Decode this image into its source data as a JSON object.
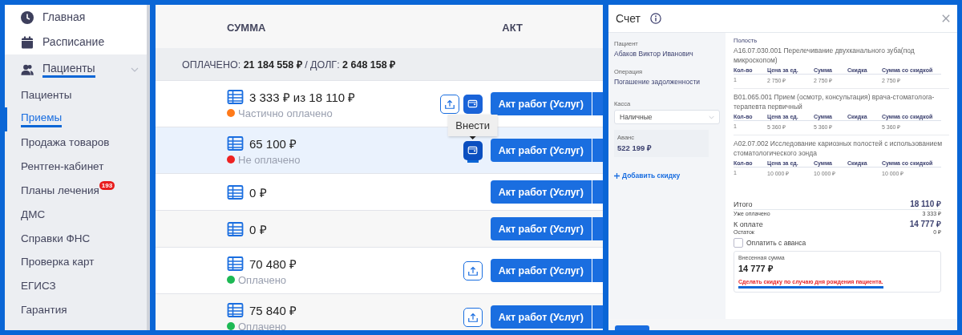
{
  "sidebar": {
    "items": [
      {
        "label": "Главная",
        "highlighted": false
      },
      {
        "label": "Расписание",
        "highlighted": false
      },
      {
        "label": "Пациенты",
        "expanded": true,
        "highlighted": true,
        "children": [
          {
            "label": "Пациенты",
            "selected": false,
            "highlighted": false
          },
          {
            "label": "Приемы",
            "selected": true,
            "highlighted": true
          },
          {
            "label": "Продажа товаров",
            "selected": false,
            "highlighted": false
          },
          {
            "label": "Рентген-кабинет",
            "selected": false,
            "highlighted": false
          },
          {
            "label": "Планы лечения",
            "selected": false,
            "highlighted": false,
            "badge": "193"
          },
          {
            "label": "ДМС",
            "selected": false,
            "highlighted": false
          },
          {
            "label": "Справки ФНС",
            "selected": false,
            "highlighted": false
          },
          {
            "label": "Проверка карт",
            "selected": false,
            "highlighted": false
          },
          {
            "label": "ЕГИСЗ",
            "selected": false,
            "highlighted": false
          },
          {
            "label": "Гарантия",
            "selected": false,
            "highlighted": false
          }
        ]
      }
    ]
  },
  "table": {
    "columns": [
      "СУММА",
      "АКТ"
    ],
    "summary": {
      "paid_label": "ОПЛАЧЕНО:",
      "paid": "21 184 558 ₽",
      "separator": "/",
      "debt_label": "ДОЛГ:",
      "debt": "2 648 158 ₽"
    },
    "rows": [
      {
        "amount": "3 333 ₽ из 18 110 ₽",
        "status": "Частично оплачено",
        "color": "#ff7a1a",
        "selected": false,
        "actions": [
          {
            "kind": "upload",
            "highlighted": false
          },
          {
            "kind": "wallet",
            "highlighted": false
          }
        ],
        "act": "Акт работ (Услуг)"
      },
      {
        "amount": "65 100 ₽",
        "status": "Не оплачено",
        "color": "#ee2222",
        "selected": true,
        "actions": [
          {
            "kind": "wallet",
            "highlighted": true,
            "tooltip": "Внести"
          }
        ],
        "act": "Акт работ (Услуг)"
      },
      {
        "amount": "0 ₽",
        "selected": false,
        "actions": [],
        "act": "Акт работ (Услуг)"
      },
      {
        "amount": "0 ₽",
        "selected": false,
        "actions": [],
        "act": "Акт работ (Услуг)"
      },
      {
        "amount": "70 480 ₽",
        "status": "Оплачено",
        "color": "#1db954",
        "selected": false,
        "actions": [
          {
            "kind": "upload",
            "highlighted": false
          }
        ],
        "act": "Акт работ (Услуг)"
      },
      {
        "amount": "75 840 ₽",
        "status": "Оплачено",
        "color": "#1db954",
        "selected": false,
        "actions": [
          {
            "kind": "upload",
            "highlighted": false
          }
        ],
        "act": "Акт работ (Услуг)"
      }
    ]
  },
  "invoice": {
    "title": "Счет",
    "fields": [
      {
        "label": "Пациент",
        "value": "Абаков Виктор Иванович"
      },
      {
        "label": "Операция",
        "value": "Погашение задолженности"
      }
    ],
    "cash_register": {
      "label": "Касса",
      "value": "Наличные"
    },
    "advance": {
      "label": "Аванс",
      "value": "522 199 ₽"
    },
    "add_discount": "Добавить скидку",
    "section_label": "Полость",
    "items": [
      {
        "name": "A16.07.030.001 Перелечивание двухканального зуба(под микроскопом)",
        "columns": [
          "Кол-во",
          "Цена за ед.",
          "Сумма",
          "Скидка",
          "Сумма со скидкой"
        ],
        "qty": "1",
        "price": "2 750 ₽",
        "sum": "2 750 ₽",
        "discounted": "2 750 ₽"
      },
      {
        "name": "B01.065.001 Прием (осмотр, консультация) врача-стоматолога-терапевта первичный",
        "columns": [
          "Кол-во",
          "Цена за ед.",
          "Сумма",
          "Скидка",
          "Сумма со скидкой"
        ],
        "qty": "1",
        "price": "5 360 ₽",
        "sum": "5 360 ₽",
        "discounted": "5 360 ₽"
      },
      {
        "name": "A02.07.002 Исследование кариозных полостей с использованием стоматологического зонда",
        "columns": [
          "Кол-во",
          "Цена за ед.",
          "Сумма",
          "Скидка",
          "Сумма со скидкой"
        ],
        "qty": "1",
        "price": "10 000 ₽",
        "sum": "10 000 ₽",
        "discounted": "10 000 ₽"
      }
    ],
    "totals": [
      {
        "label": "Итого",
        "value": "18 110 ₽",
        "kind": "major"
      },
      {
        "label": "Уже оплачено",
        "value": "3 333 ₽",
        "kind": "minor"
      },
      {
        "label": "К оплате",
        "value": "14 777 ₽",
        "kind": "major"
      },
      {
        "label": "Остаток",
        "value": "0 ₽",
        "kind": "minor"
      }
    ],
    "pay_from_advance": {
      "label": "Оплатить с аванса",
      "checked": false
    },
    "deposit": {
      "label": "Внесенная сумма",
      "value": "14 777 ₽",
      "warning": "Сделать скидку по случаю дня рождения пациента.",
      "highlighted": true
    }
  }
}
